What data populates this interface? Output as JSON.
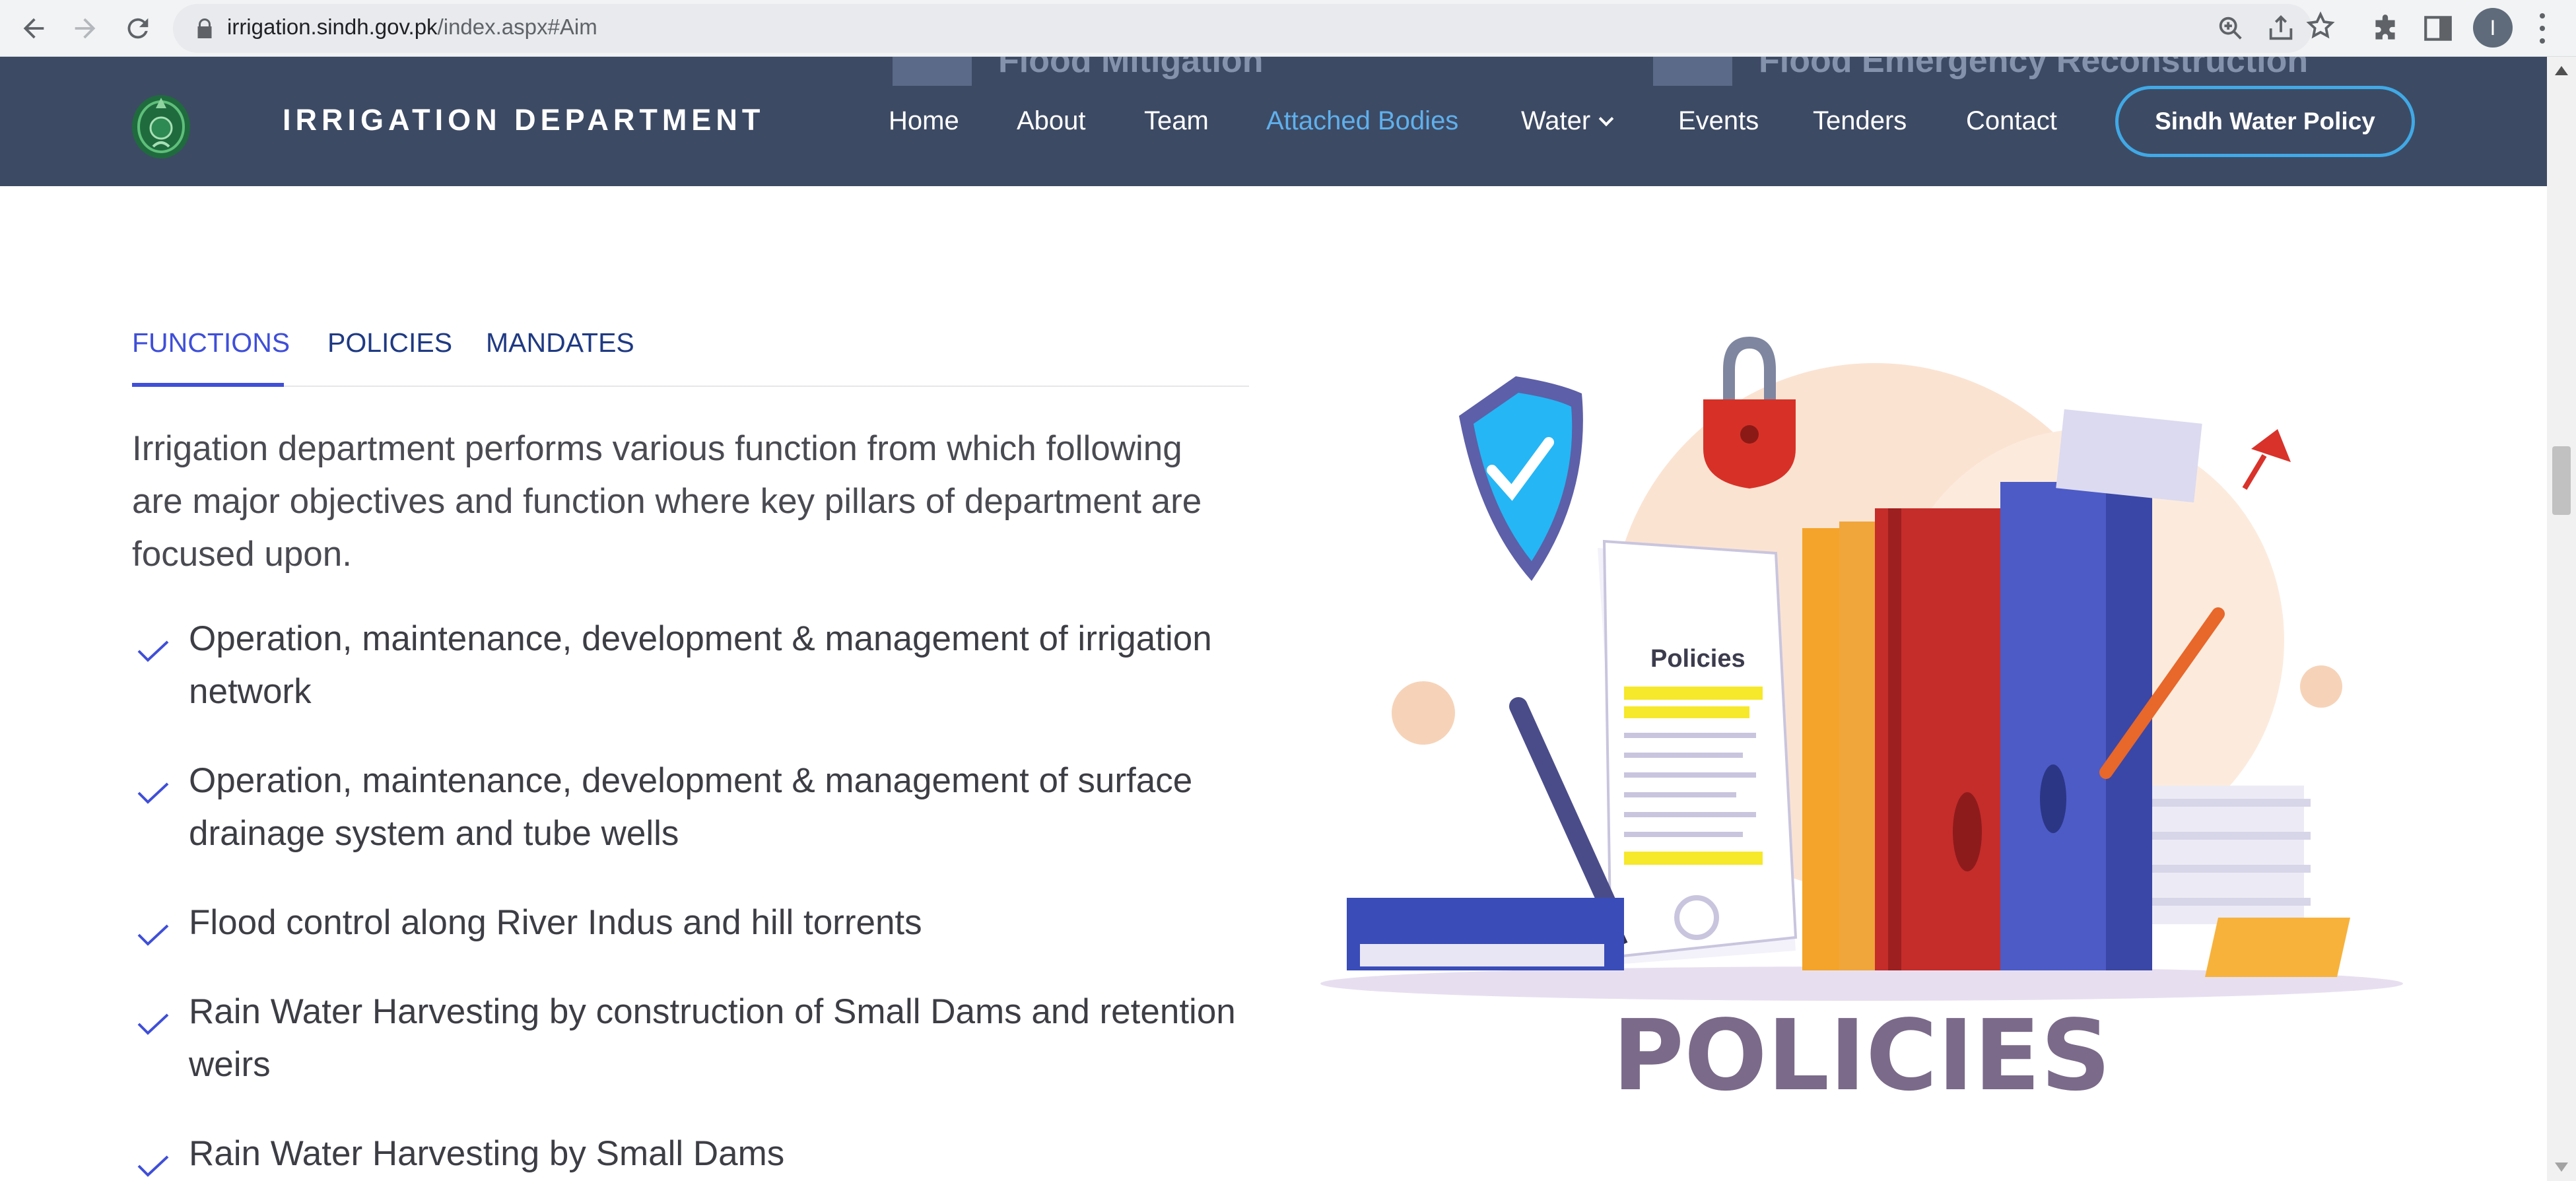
{
  "browser": {
    "url_host": "irrigation.sindh.gov.pk",
    "url_path": "/index.aspx#Aim",
    "profile_initial": "I"
  },
  "peek": {
    "left_text": "Flood Mitigation",
    "right_text": "Flood Emergency Reconstruction"
  },
  "header": {
    "brand": "IRRIGATION DEPARTMENT",
    "menu": [
      {
        "label": "Home"
      },
      {
        "label": "About"
      },
      {
        "label": "Team"
      },
      {
        "label": "Attached Bodies",
        "active": true
      },
      {
        "label": "Water"
      },
      {
        "label": "Events"
      },
      {
        "label": "Tenders"
      },
      {
        "label": "Contact"
      }
    ],
    "cta": "Sindh Water Policy",
    "colors": {
      "bar": "#3d4a64",
      "active": "#5fb0ec",
      "cta_border": "#40a9e6"
    }
  },
  "tabs": [
    {
      "label": "FUNCTIONS",
      "active": true
    },
    {
      "label": "POLICIES"
    },
    {
      "label": "MANDATES"
    }
  ],
  "content": {
    "intro": "Irrigation department performs various function from which following are major objectives and function where key pillars of department are focused upon.",
    "functions": [
      "Operation, maintenance, development & management of irrigation network",
      "Operation, maintenance, development & management of surface drainage system and tube wells",
      "Flood control along River Indus and hill torrents",
      "Rain Water Harvesting by construction of Small Dams and retention weirs",
      "Rain Water Harvesting by Small Dams"
    ]
  },
  "illustration": {
    "doc_label": "Policies",
    "caption": "POLICIES"
  }
}
